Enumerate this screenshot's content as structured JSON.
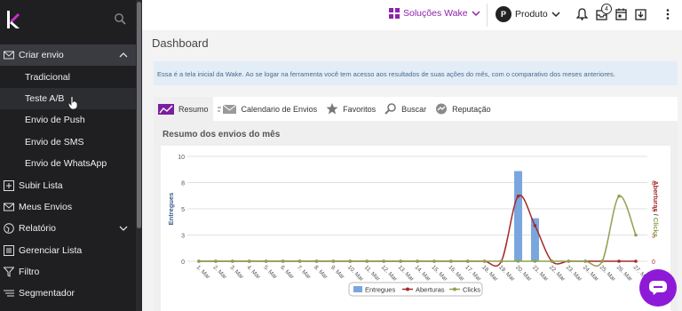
{
  "sidebar": {
    "items": [
      {
        "label": "Criar envio",
        "icon": "mail-icon",
        "chevron": "chevron-up-icon"
      },
      {
        "label": "Tradicional"
      },
      {
        "label": "Teste A/B"
      },
      {
        "label": "Envio de Push"
      },
      {
        "label": "Envio de SMS"
      },
      {
        "label": "Envio de WhatsApp"
      },
      {
        "label": "Subir Lista",
        "icon": "upload-box-icon"
      },
      {
        "label": "Meus Envios",
        "icon": "mail-icon"
      },
      {
        "label": "Relatório",
        "icon": "globe-icon",
        "chevron": "chevron-down-icon"
      },
      {
        "label": "Gerenciar Lista",
        "icon": "list-icon"
      },
      {
        "label": "Filtro",
        "icon": "filter-icon"
      },
      {
        "label": "Segmentador",
        "icon": "segment-icon"
      }
    ]
  },
  "topbar": {
    "brand_label": "Soluções Wake",
    "profile_initial": "P",
    "profile_label": "Produto",
    "badge_count": "4",
    "accent": "#8e24aa"
  },
  "main": {
    "title": "Dashboard",
    "info_text": "Essa é a tela inicial da Wake. Ao se logar na ferramenta você tem acesso aos resultados de suas ações do mês, com o comparativo dos meses anteriores.",
    "tabs": [
      {
        "label": "Resumo",
        "icon": "trend-icon"
      },
      {
        "label": "Calendario de Envios",
        "icon": "mail-send-icon"
      },
      {
        "label": "Favoritos",
        "icon": "star-icon"
      },
      {
        "label": "Buscar",
        "icon": "search-icon"
      },
      {
        "label": "Reputação",
        "icon": "reputation-icon"
      }
    ],
    "card_title": "Resumo dos envios do mês"
  },
  "chart_data": {
    "type": "bar",
    "categories": [
      "1. Mar",
      "2. Mar",
      "3. Mar",
      "4. Mar",
      "5. Mar",
      "6. Mar",
      "7. Mar",
      "8. Mar",
      "9. Mar",
      "10. Mar",
      "11. Mar",
      "12. Mar",
      "13. Mar",
      "14. Mar",
      "15. Mar",
      "16. Mar",
      "17. Mar",
      "18. Mar",
      "19. Mar",
      "20. Mar",
      "21. Mar",
      "22. Mar",
      "23. Mar",
      "24. Mar",
      "25. Mar",
      "26. Mar",
      "27. Mar"
    ],
    "y_left_ticks": [
      "10",
      "8",
      "5",
      "3",
      "0"
    ],
    "y_right_ticks": [
      "8",
      "5",
      "3",
      "0"
    ],
    "ylabel_left": "Entregues",
    "ylabel_right_a": "Aberturas",
    "ylabel_right_sep": "/",
    "ylabel_right_b": "Clicks",
    "ylim_left": [
      0,
      10
    ],
    "ylim_right": [
      0,
      10
    ],
    "series": [
      {
        "name": "Entregues",
        "type": "bar",
        "color": "#7aa6de",
        "values": [
          0,
          0,
          0,
          0,
          0,
          0,
          0,
          0,
          0,
          0,
          0,
          0,
          0,
          0,
          0,
          0,
          0,
          0,
          0,
          8.6,
          4.1,
          0,
          0,
          0,
          0,
          0,
          0
        ]
      },
      {
        "name": "Aberturas",
        "type": "spline",
        "color": "#a52a2a",
        "values": [
          0,
          0,
          0,
          0,
          0,
          0,
          0,
          0,
          0,
          0,
          0,
          0,
          0,
          0,
          0,
          0,
          0,
          0,
          0,
          6.2,
          3.4,
          0,
          0,
          0,
          0,
          0,
          0
        ]
      },
      {
        "name": "Clicks",
        "type": "spline",
        "color": "#8fa14e",
        "values": [
          0,
          0,
          0,
          0,
          0,
          0,
          0,
          0,
          0,
          0,
          0,
          0,
          0,
          0,
          0,
          0,
          0,
          0,
          0,
          0,
          0,
          0,
          0,
          0,
          0,
          6.2,
          2.5
        ]
      }
    ]
  }
}
